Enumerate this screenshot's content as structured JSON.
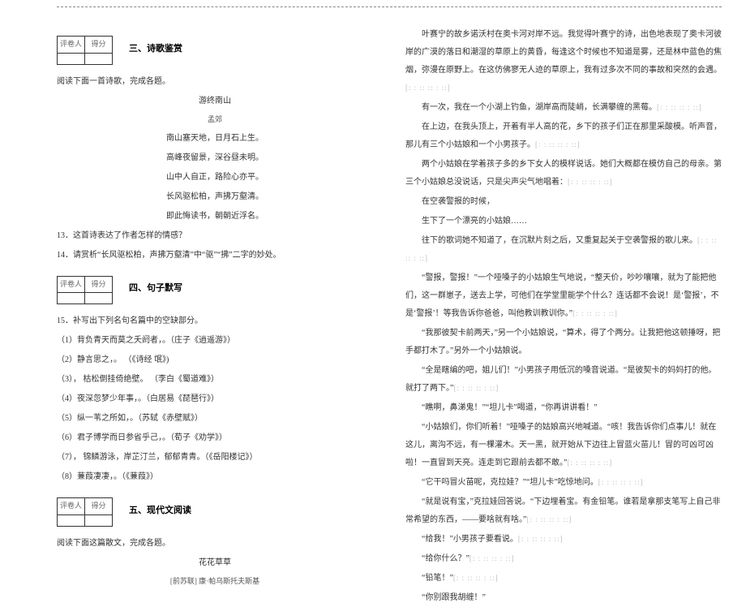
{
  "scorebox": {
    "grader": "评卷人",
    "score": "得分"
  },
  "sections": {
    "s3": "三、诗歌鉴赏",
    "s4": "四、句子默写",
    "s5": "五、现代文阅读"
  },
  "left": {
    "read_poem": "阅读下面一首诗歌，完成各题。",
    "poem_title": "游终南山",
    "poem_author": "孟郊",
    "poem_lines": [
      "南山塞天地，日月石上生。",
      "高峰夜留景，深谷昼未明。",
      "山中人自正，路险心亦平。",
      "长风驱松柏，声拂万壑清。",
      "即此悔读书，朝朝近浮名。"
    ],
    "q13": "13．这首诗表达了作者怎样的情感？",
    "q14": "14．请赏析“长风驱松柏，声拂万壑清”中“驱”“拂”二字的妙处。",
    "q15_intro": "15．补写出下列名句名篇中的空缺部分。",
    "q15_items": [
      "（1）背负青天而莫之夭阏者，。（庄子《逍遥游》）",
      "（2）静言思之，。 （《诗经 氓》)",
      "（3）， 枯松倒挂倚绝壁。 （李白《蜀道难》）",
      "（4）夜深忽梦少年事，。（白居易《琵琶行》）",
      "（5）纵一苇之所如，。（苏轼《赤壁赋》）",
      "（6）君子博学而日参省乎己，。（荀子《劝学》）",
      "（7）， 锦鳞游泳，岸芷汀兰，郁郁青青。（《岳阳楼记》）",
      "（8）蒹葭凄凄，。（《蒹葭》）"
    ],
    "read_prose": "阅读下面这篇散文，完成各题。",
    "prose_title": "花花草草",
    "prose_author": "[前苏联] 康·帕乌斯托夫斯基"
  },
  "right": {
    "paras": [
      "叶赛宁的故乡诺沃村在奥卡河对岸不远。我觉得叶赛宁的诗，出色地表现了奥卡河彼岸的广漠的落日和潮湿的草原上的黄昏，每逢这个时候也不知道是雾，还是林中蓝色的焦烟，弥漫在原野上。在这仿佛寥无人迹的草原上，我有过多次不同的事故和突然的会遇。",
      "有一次，我在一个小湖上钓鱼，湖岸高而陡峭，长满攀缠的黑莓。",
      "在上边，在我头顶上，开着有半人高的花，乡下的孩子们正在那里采酸模。听声音，那儿有三个小姑娘和一个小男孩子。",
      "两个小姑娘在学着孩子多的乡下女人的模样说话。她们大概都在模仿自己的母亲。第三个小姑娘总没说话，只是尖声尖气地唱着：",
      "在空袭警报的时候，",
      "生下了一个漂亮的小姑娘……",
      "往下的歌词她不知道了，在沉默片刻之后，又重复起关于空袭警报的歌儿来。",
      "“警报，警报！”一个哑嗓子的小姑娘生气地说，“整天价，吵吵嚷嚷，就为了能把他们，这一群崽子，送去上学，可他们在学堂里能学个什么？连话都不会说！是‘警报’，不是‘警报’！等我告诉你爸爸，叫他教训教训你。”",
      "“我那彼契卡前两天，”另一个小姑娘说，“算术，得了个两分。让我把他这顿捶呀，把手都打木了。”另外一个小姑娘说。",
      "“全是瞎编的吧，姐儿们！”小男孩子用低沉的嗓音说道。“是彼契卡的妈妈打的他。就打了两下。”",
      "“瞧啊，鼻涕鬼！”“坦儿卡”喝道，“你再讲讲看！”",
      "“小姑娘们，你们听着！”哑嗓子的姑娘高兴地喊道。“咳！我告诉你们点事儿！就在这儿，离沟不远，有一棵灌木。天一黑，就开始从下边往上冒蓝火苗儿！冒的可凶可凶啦！一直冒到天亮。连走到它跟前去都不敢。”",
      "“它干吗冒火苗呢，克拉娃？”“坦儿卡”吃惊地问。",
      "“就是说有宝，”克拉娃回答说。“下边埋着宝。有金铅笔。谁若是拿那支笔写上自己非常希望的东西，——要啥就有啥。”",
      "“给我！”小男孩子要看说。",
      "“给你什么？”",
      "“铅笔！”",
      "“你别跟我胡缠！”"
    ]
  },
  "corner": "[: : :: :: : ::]"
}
